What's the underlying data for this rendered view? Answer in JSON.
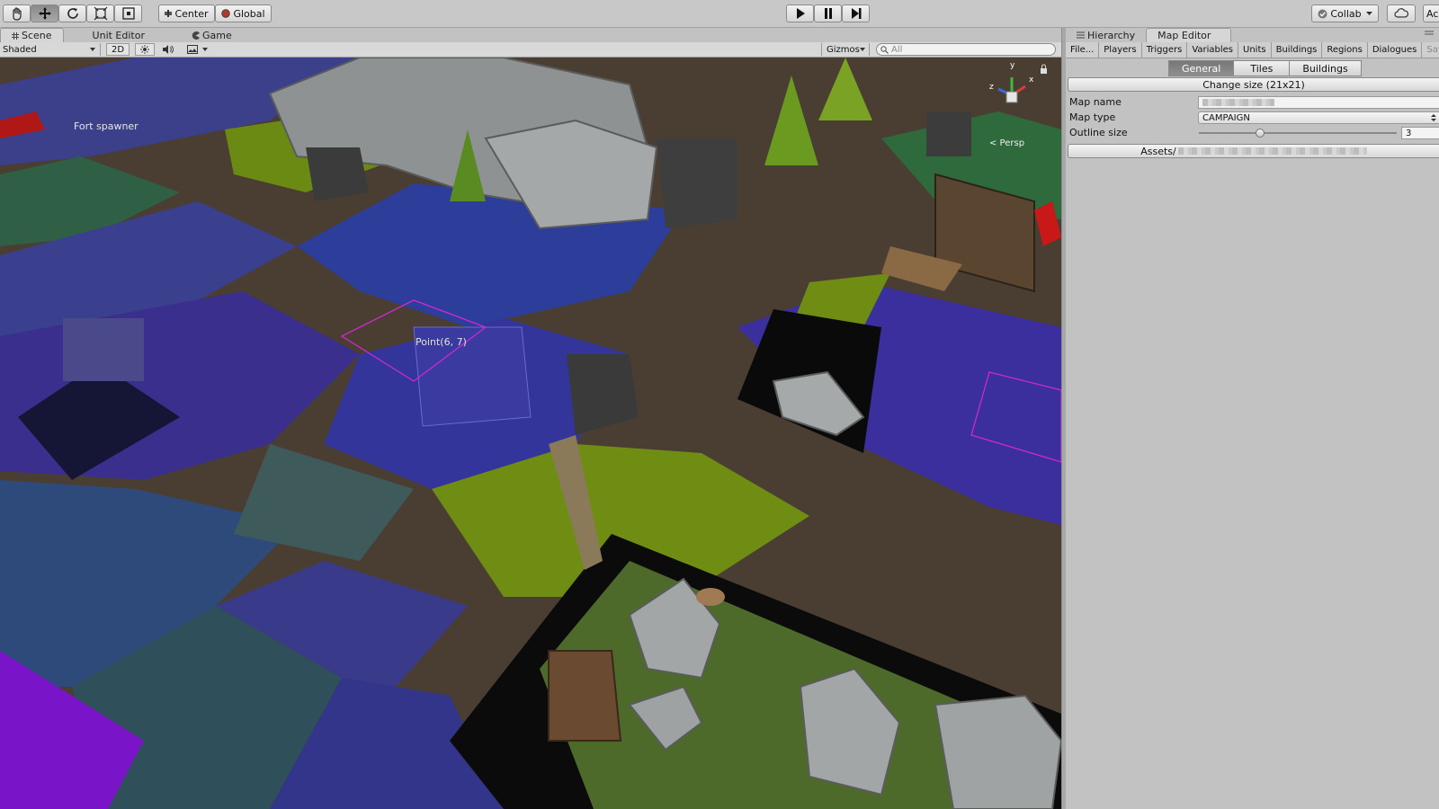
{
  "toolbar": {
    "pivot_label": "Center",
    "space_label": "Global",
    "collab_label": "Collab",
    "account_label": "Ac"
  },
  "scene_tabs": [
    "Scene",
    "Unit Editor",
    "Game"
  ],
  "scene_bar": {
    "shading_mode": "Shaded",
    "mode_2d": "2D",
    "gizmos_label": "Gizmos",
    "search_placeholder": "All"
  },
  "viewport": {
    "labels": {
      "spawner": "Fort spawner",
      "point": "Point(6, 7)",
      "persp": "< Persp",
      "axis_x": "x",
      "axis_y": "y",
      "axis_z": "z"
    }
  },
  "right_tabs": [
    "Hierarchy",
    "Map Editor"
  ],
  "map_editor": {
    "menu": [
      "File...",
      "Players",
      "Triggers",
      "Variables",
      "Units",
      "Buildings",
      "Regions",
      "Dialogues",
      "Save"
    ],
    "subtabs": [
      "General",
      "Tiles",
      "Buildings"
    ],
    "active_subtab": "General",
    "change_size_label": "Change size (21x21)",
    "map_name_label": "Map name",
    "map_type_label": "Map type",
    "map_type_value": "CAMPAIGN",
    "outline_size_label": "Outline size",
    "outline_size_value": "3",
    "outline_size_fraction": 0.3,
    "assets_label": "Assets/"
  }
}
